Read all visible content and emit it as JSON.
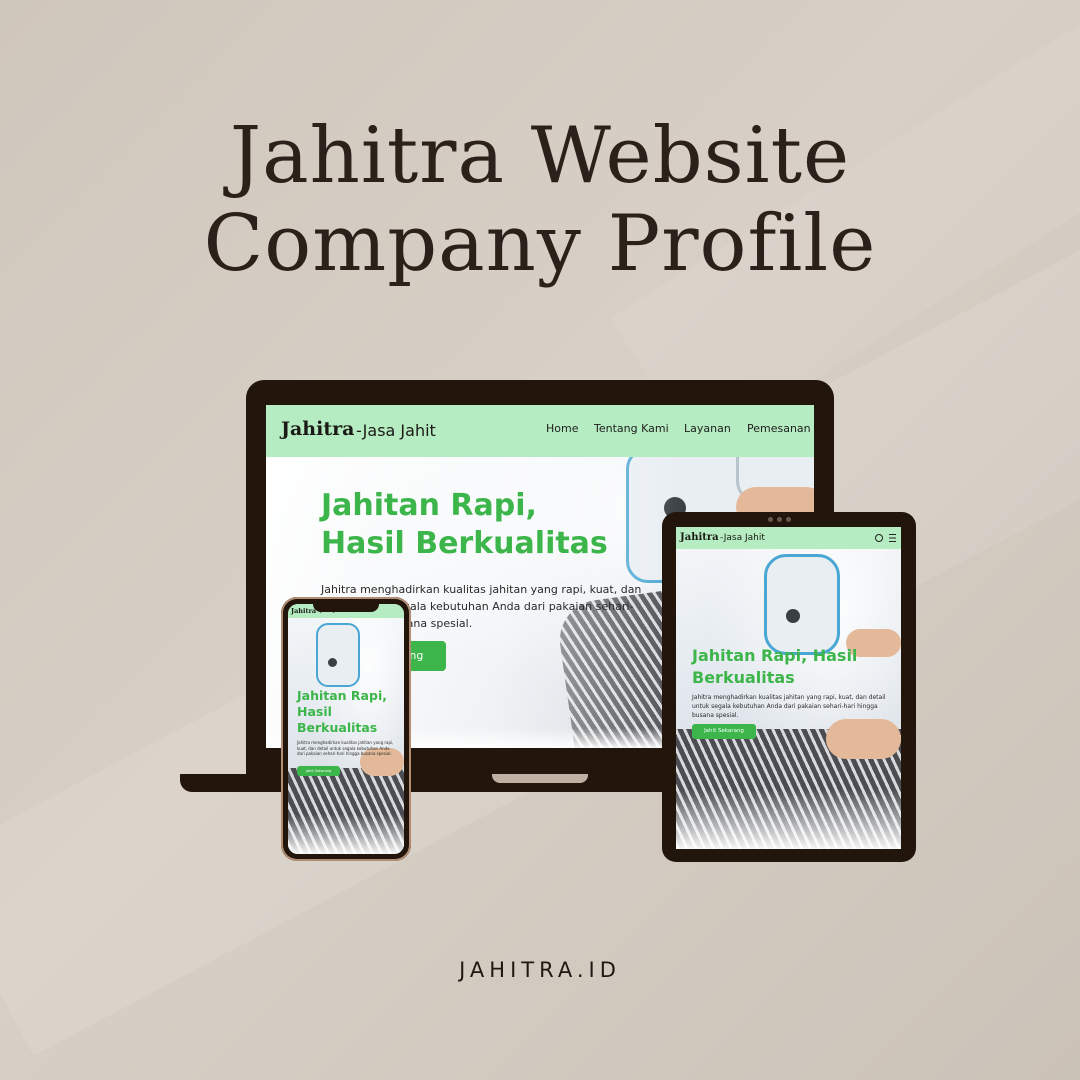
{
  "heading": {
    "line1": "Jahitra Website",
    "line2": "Company Profile"
  },
  "footer": "JAHITRA.ID",
  "site": {
    "logo": "Jahitra",
    "tagline": "-Jasa Jahit",
    "nav": [
      "Home",
      "Tentang Kami",
      "Layanan",
      "Pemesanan"
    ],
    "hero_title_line1": "Jahitan Rapi,",
    "hero_title_line2": "Hasil Berkualitas",
    "tablet_title_line1": "Jahitan Rapi, Hasil",
    "tablet_title_line2": "Berkualitas",
    "phone_title_line1": "Jahitan Rapi,",
    "phone_title_line2": "Hasil",
    "phone_title_line3": "Berkualitas",
    "hero_text": "Jahitra menghadirkan kualitas jahitan yang rapi, kuat, dan detail untuk segala kebutuhan Anda dari pakaian sehari-hari hingga busana spesial.",
    "cta": "Jahit Sekarang"
  },
  "colors": {
    "accent": "#3cb54a",
    "nav_bg": "#b5ecc1",
    "device": "#22150c"
  },
  "icons": [
    "search-icon",
    "menu-icon"
  ]
}
